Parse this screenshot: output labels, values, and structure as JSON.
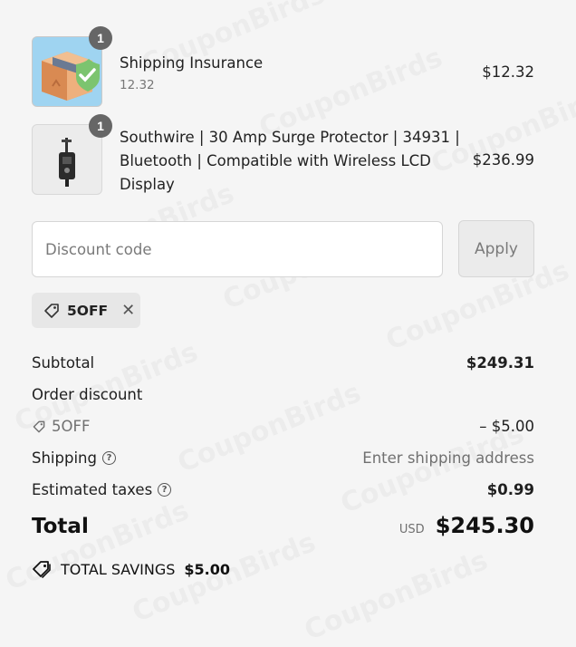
{
  "watermark": "CouponBirds",
  "items": [
    {
      "title": "Shipping Insurance",
      "subtitle": "12.32",
      "price": "$12.32",
      "quantity": "1",
      "image": "package-shield-icon"
    },
    {
      "title_lines": [
        "Southwire | 30 Amp Surge Protector | 34931 |",
        "Bluetooth | Compatible with Wireless LCD",
        "Display"
      ],
      "price": "$236.99",
      "quantity": "1",
      "image": "surge-protector-icon"
    }
  ],
  "discount": {
    "placeholder": "Discount code",
    "apply_label": "Apply",
    "applied_code": "5OFF"
  },
  "summary": {
    "subtotal_label": "Subtotal",
    "subtotal_value": "$249.31",
    "order_discount_label": "Order discount",
    "discount_code": "5OFF",
    "discount_value": "– $5.00",
    "shipping_label": "Shipping",
    "shipping_value": "Enter shipping address",
    "taxes_label": "Estimated taxes",
    "taxes_value": "$0.99",
    "total_label": "Total",
    "currency": "USD",
    "total_value": "$245.30",
    "savings_label": "TOTAL SAVINGS",
    "savings_value": "$5.00"
  }
}
